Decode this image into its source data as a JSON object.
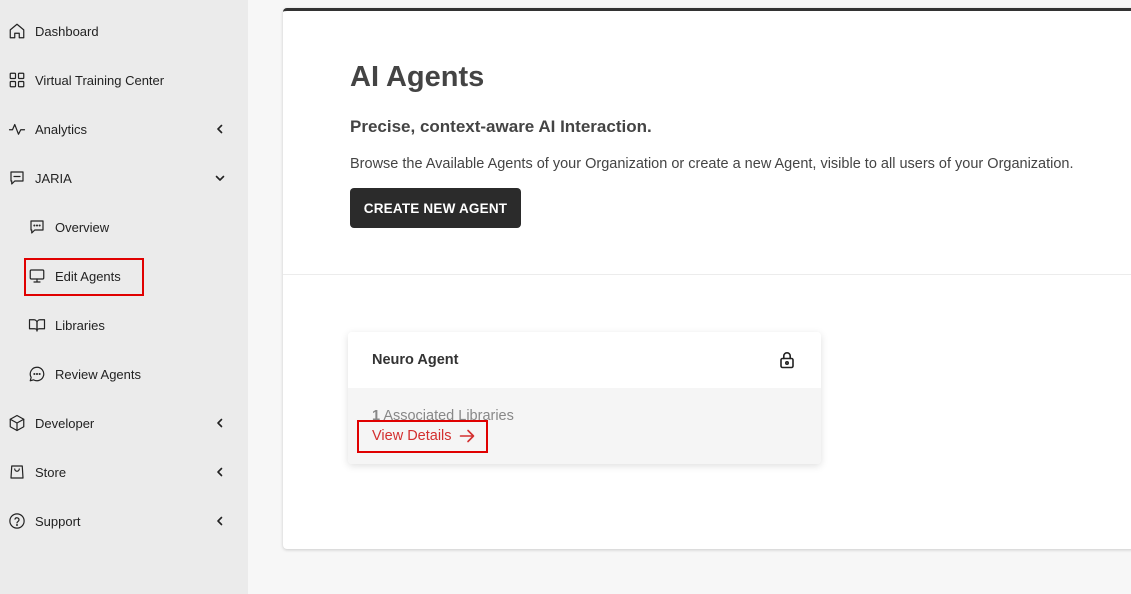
{
  "sidebar": {
    "items": [
      {
        "label": "Dashboard",
        "icon": "home-icon"
      },
      {
        "label": "Virtual Training Center",
        "icon": "grid-icon"
      },
      {
        "label": "Analytics",
        "icon": "activity-icon",
        "chevron": "left"
      },
      {
        "label": "JARIA",
        "icon": "chat-icon",
        "chevron": "down"
      },
      {
        "label": "Overview",
        "icon": "message-icon"
      },
      {
        "label": "Edit Agents",
        "icon": "monitor-icon"
      },
      {
        "label": "Libraries",
        "icon": "book-icon"
      },
      {
        "label": "Review Agents",
        "icon": "comment-icon"
      },
      {
        "label": "Developer",
        "icon": "box-icon",
        "chevron": "left"
      },
      {
        "label": "Store",
        "icon": "shopping-bag-icon",
        "chevron": "left"
      },
      {
        "label": "Support",
        "icon": "help-circle-icon",
        "chevron": "left"
      }
    ]
  },
  "main": {
    "title": "AI Agents",
    "subtitle": "Precise, context-aware AI Interaction.",
    "description": "Browse the Available Agents of your Organization or create a new Agent, visible to all users of your Organization.",
    "create_button": "CREATE NEW AGENT",
    "agents": [
      {
        "name": "Neuro Agent",
        "library_count": "1",
        "library_label": "Associated Libraries",
        "link_label": "View Details",
        "locked": true
      }
    ]
  },
  "colors": {
    "sidebar_bg": "#ebebeb",
    "highlight": "#e00000",
    "link": "#d32f2f",
    "button_bg": "#2b2b2b"
  }
}
